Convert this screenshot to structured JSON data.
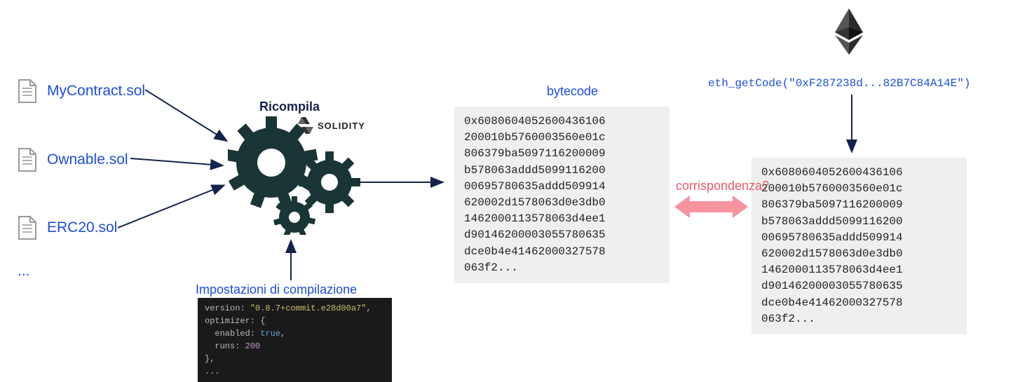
{
  "files": [
    {
      "label": "MyContract.sol"
    },
    {
      "label": "Ownable.sol"
    },
    {
      "label": "ERC20.sol"
    }
  ],
  "ellipsis": "...",
  "recompile": "Ricompila",
  "solidity": "SOLIDITY",
  "settings_label": "Impostazioni di compilazione",
  "settings_code": {
    "l1_key": "version:",
    "l1_val": "\"0.8.7+commit.e28d00a7\"",
    "l2": "optimizer: {",
    "l3_key": "enabled:",
    "l3_val": "true",
    "l4_key": "runs:",
    "l4_val": "200",
    "l5": "},",
    "l6": "..."
  },
  "bytecode_label": "bytecode",
  "bytecode1": "0x6080604052600436106200010b5760003560e01c806379ba5097116200009b578063addd509911620000695780635addd509914620002d1578063d0e3db01462000113578063d4ee1d90146200003055780635dce0b4e41462000327578063f2...",
  "bytecode2": "0x6080604052600436106200010b5760003560e01c806379ba5097116200009b578063addd509911620000695780635addd509914620002d1578063d0e3db01462000113578063d4ee1d90146200003055780635dce0b4e41462000327578063f2...",
  "eth_call_fn": "eth_getCode",
  "eth_call_arg": "(\"0xF287238d...82B7C84A14E\")",
  "match": "corrispondenza?"
}
